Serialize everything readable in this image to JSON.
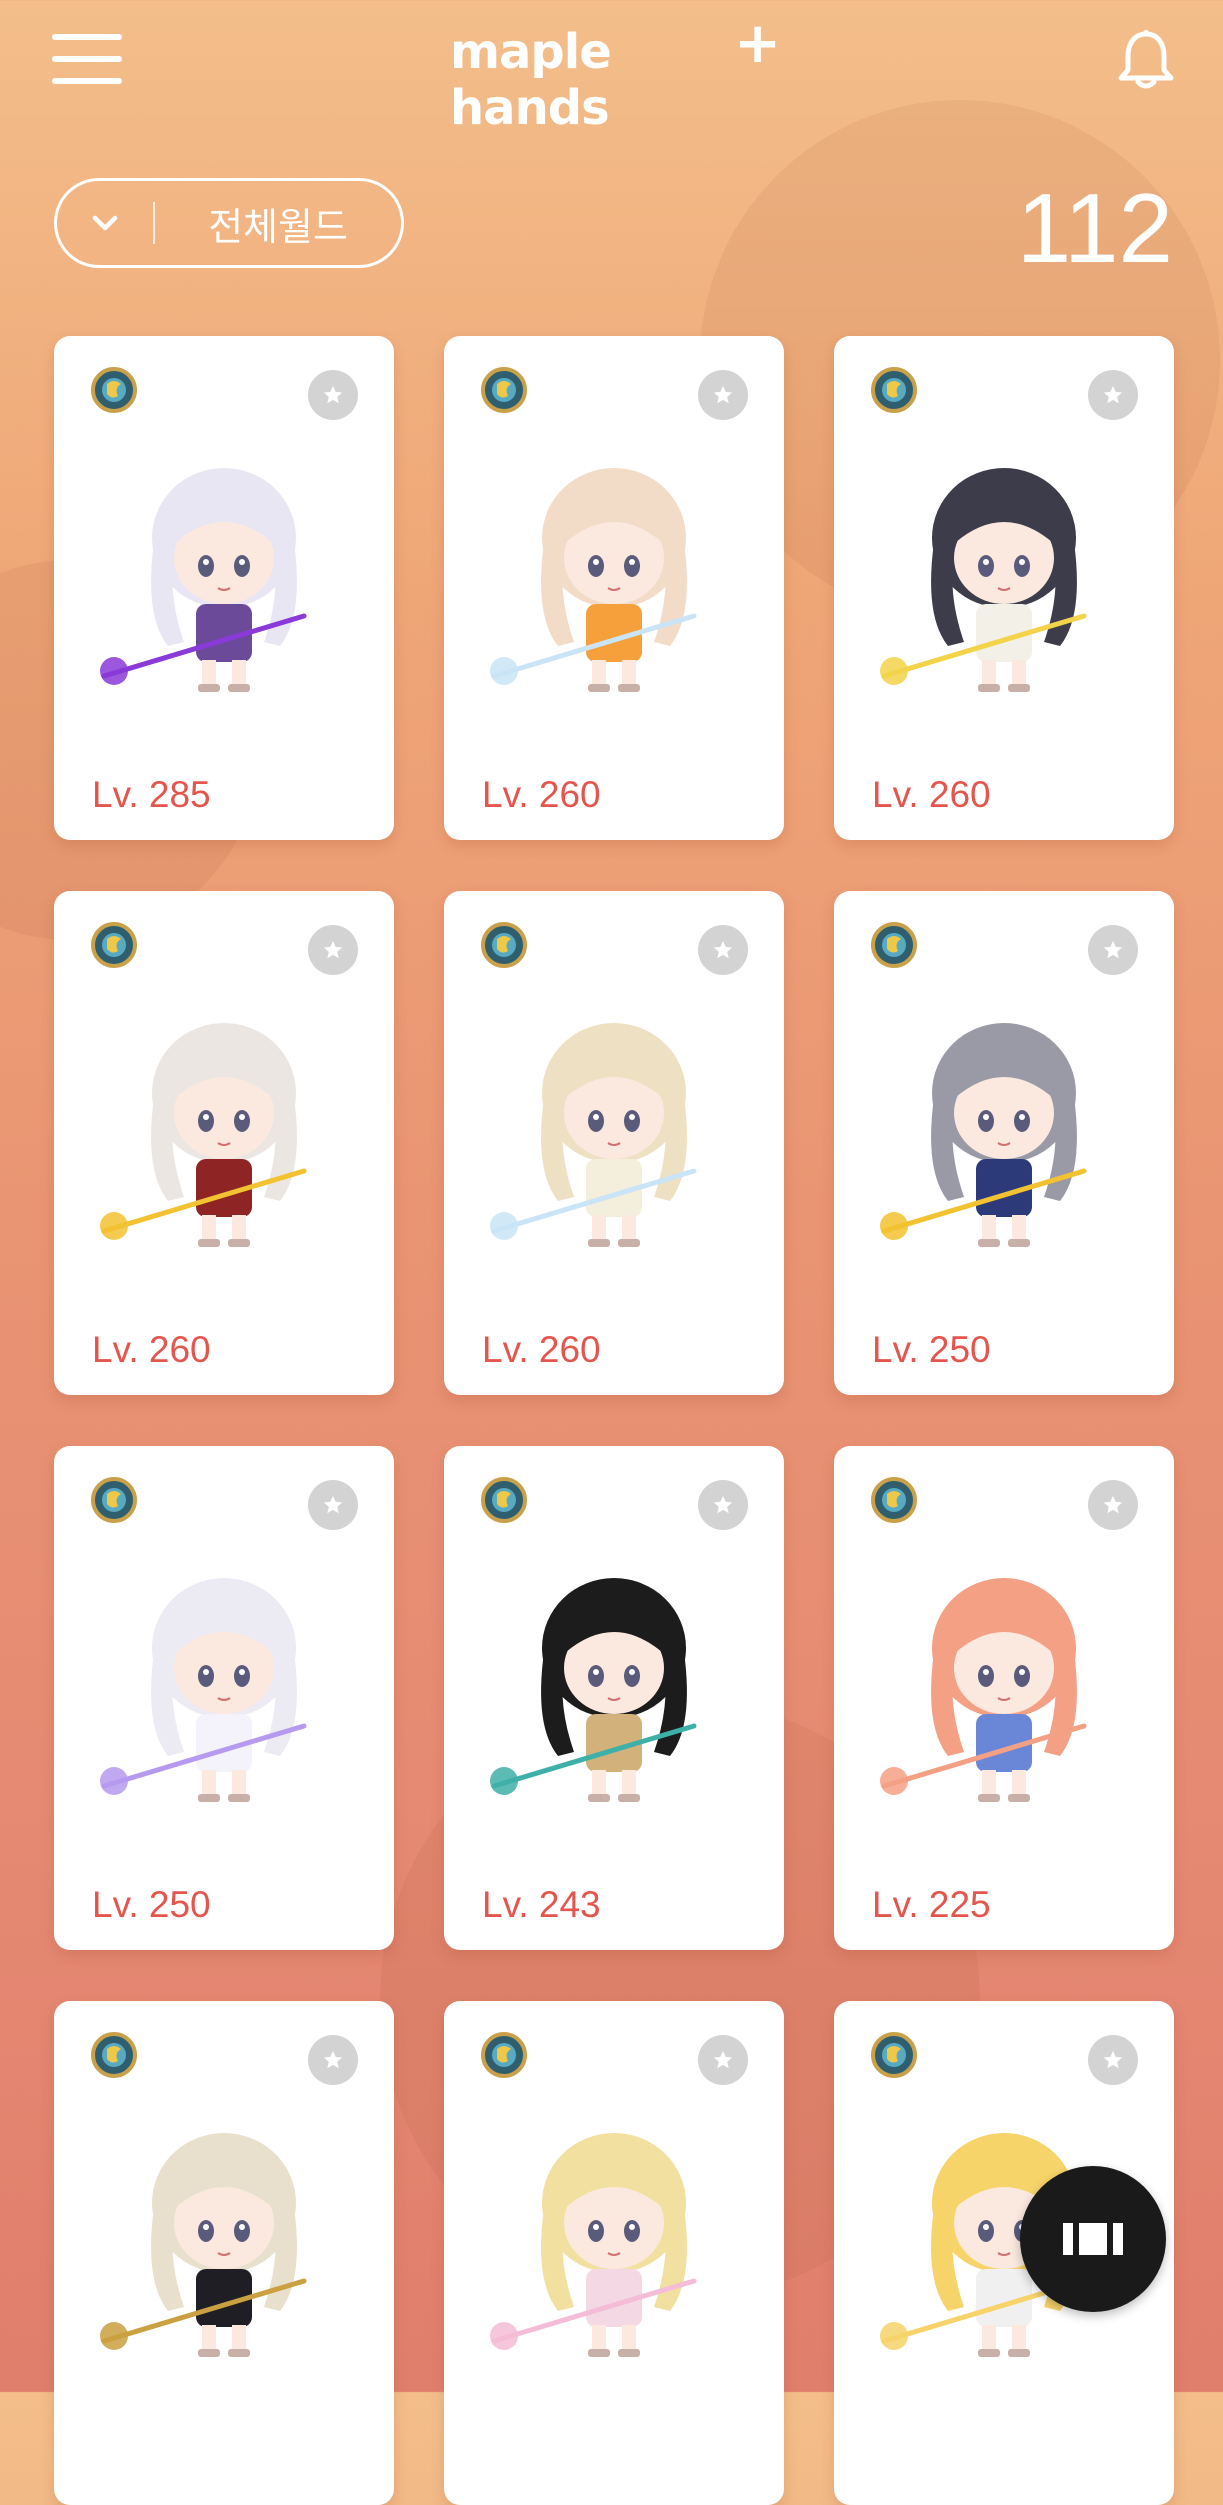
{
  "header": {
    "logo_text": "maple hands",
    "logo_plus": "+",
    "menu_icon": "hamburger-menu-icon",
    "bell_icon": "bell-icon"
  },
  "filter": {
    "world_label": "전체월드",
    "dropdown_icon": "chevron-down-icon"
  },
  "character_count": "112",
  "colors": {
    "level_text": "#e4554d",
    "card_bg": "#ffffff",
    "fab_bg": "#1a1a1a",
    "background_top": "#f3be8a",
    "background_bottom": "#e07f6c"
  },
  "characters": [
    {
      "level": "Lv. 285",
      "hair": "#e9e6f3",
      "outfit": "#6b4a9a",
      "accent": "#8a3ad8"
    },
    {
      "level": "Lv. 260",
      "hair": "#f2dcc8",
      "outfit": "#f5a03a",
      "accent": "#c9e4f6"
    },
    {
      "level": "Lv. 260",
      "hair": "#3c3c4a",
      "outfit": "#f3f0e8",
      "accent": "#f2d34a"
    },
    {
      "level": "Lv. 260",
      "hair": "#ece6e2",
      "outfit": "#8e2424",
      "accent": "#f2c230"
    },
    {
      "level": "Lv. 260",
      "hair": "#eee0c2",
      "outfit": "#f4eedc",
      "accent": "#c9e4f6"
    },
    {
      "level": "Lv. 250",
      "hair": "#9a9aa6",
      "outfit": "#2c3a7a",
      "accent": "#f2c230"
    },
    {
      "level": "Lv. 250",
      "hair": "#ecebf4",
      "outfit": "#f4f2fa",
      "accent": "#b69af0"
    },
    {
      "level": "Lv. 243",
      "hair": "#1c1c1c",
      "outfit": "#d2b27a",
      "accent": "#3fb0a8"
    },
    {
      "level": "Lv. 225",
      "hair": "#f4a084",
      "outfit": "#6a86d6",
      "accent": "#f4a084"
    },
    {
      "level": "",
      "hair": "#e8e0cc",
      "outfit": "#1e1e24",
      "accent": "#caa040"
    },
    {
      "level": "",
      "hair": "#f2e0a0",
      "outfit": "#f4d8e4",
      "accent": "#f4bcd6"
    },
    {
      "level": "",
      "hair": "#f6d46a",
      "outfit": "#f0f0f0",
      "accent": "#f6d46a"
    }
  ],
  "card_icons": {
    "world": "world-emblem-icon",
    "favorite": "star-icon"
  },
  "fab": {
    "icon": "card-view-icon"
  }
}
